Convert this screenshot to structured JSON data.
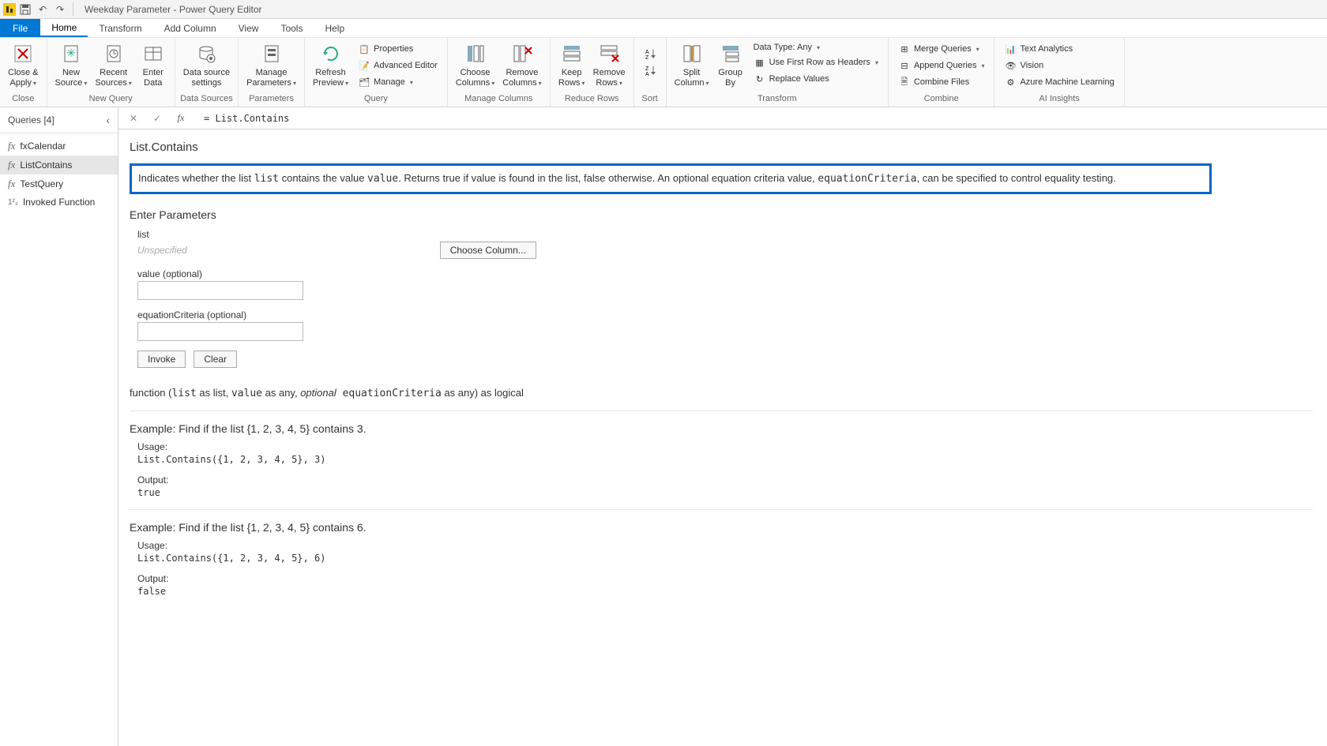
{
  "title": "Weekday Parameter - Power Query Editor",
  "menubar": {
    "file": "File",
    "tabs": [
      "Home",
      "Transform",
      "Add Column",
      "View",
      "Tools",
      "Help"
    ],
    "active": "Home"
  },
  "ribbon": {
    "close": {
      "line1": "Close &",
      "line2": "Apply",
      "group": "Close"
    },
    "newquery": {
      "group": "New Query",
      "new_source": {
        "line1": "New",
        "line2": "Source"
      },
      "recent_sources": {
        "line1": "Recent",
        "line2": "Sources"
      },
      "enter_data": {
        "line1": "Enter",
        "line2": "Data"
      }
    },
    "datasources": {
      "group": "Data Sources",
      "btn": {
        "line1": "Data source",
        "line2": "settings"
      }
    },
    "parameters": {
      "group": "Parameters",
      "btn": {
        "line1": "Manage",
        "line2": "Parameters"
      }
    },
    "query": {
      "group": "Query",
      "refresh": {
        "line1": "Refresh",
        "line2": "Preview"
      },
      "properties": "Properties",
      "advanced": "Advanced Editor",
      "manage": "Manage"
    },
    "manage_columns": {
      "group": "Manage Columns",
      "choose": {
        "line1": "Choose",
        "line2": "Columns"
      },
      "remove": {
        "line1": "Remove",
        "line2": "Columns"
      }
    },
    "reduce_rows": {
      "group": "Reduce Rows",
      "keep": {
        "line1": "Keep",
        "line2": "Rows"
      },
      "remove": {
        "line1": "Remove",
        "line2": "Rows"
      }
    },
    "sort": {
      "group": "Sort"
    },
    "transform": {
      "group": "Transform",
      "split": {
        "line1": "Split",
        "line2": "Column"
      },
      "groupby": {
        "line1": "Group",
        "line2": "By"
      },
      "datatype": "Data Type: Any",
      "first_row": "Use First Row as Headers",
      "replace": "Replace Values"
    },
    "combine": {
      "group": "Combine",
      "merge": "Merge Queries",
      "append": "Append Queries",
      "files": "Combine Files"
    },
    "ai": {
      "group": "AI Insights",
      "text": "Text Analytics",
      "vision": "Vision",
      "ml": "Azure Machine Learning"
    }
  },
  "queries": {
    "header": "Queries [4]",
    "items": [
      {
        "name": "fxCalendar",
        "icon": "fx"
      },
      {
        "name": "ListContains",
        "icon": "fx",
        "selected": true
      },
      {
        "name": "TestQuery",
        "icon": "fx"
      },
      {
        "name": "Invoked Function",
        "icon": "123"
      }
    ]
  },
  "formula": "= List.Contains",
  "doc": {
    "title": "List.Contains",
    "description_pre": "Indicates whether the list ",
    "description_code1": "list",
    "description_mid": " contains the value ",
    "description_code2": "value",
    "description_mid2": ". Returns true if value is found in the list, false otherwise. An optional equation criteria value, ",
    "description_code3": "equationCriteria",
    "description_post": ", can be specified to control equality testing.",
    "enter_params": "Enter Parameters",
    "params": {
      "list_label": "list",
      "unspecified": "Unspecified",
      "choose_column": "Choose Column...",
      "value_label": "value (optional)",
      "eq_label": "equationCriteria (optional)"
    },
    "invoke": "Invoke",
    "clear": "Clear",
    "signature": {
      "prefix": "function (",
      "p1": "list",
      "p1t": " as list, ",
      "p2": "value",
      "p2t": " as any, ",
      "opt": "optional",
      "p3": " equationCriteria",
      "p3t": " as any) as logical"
    },
    "examples": [
      {
        "title": "Example: Find if the list {1, 2, 3, 4, 5} contains 3.",
        "usage_label": "Usage:",
        "usage": "List.Contains({1, 2, 3, 4, 5}, 3)",
        "output_label": "Output:",
        "output": "true"
      },
      {
        "title": "Example: Find if the list {1, 2, 3, 4, 5} contains 6.",
        "usage_label": "Usage:",
        "usage": "List.Contains({1, 2, 3, 4, 5}, 6)",
        "output_label": "Output:",
        "output": "false"
      }
    ]
  }
}
